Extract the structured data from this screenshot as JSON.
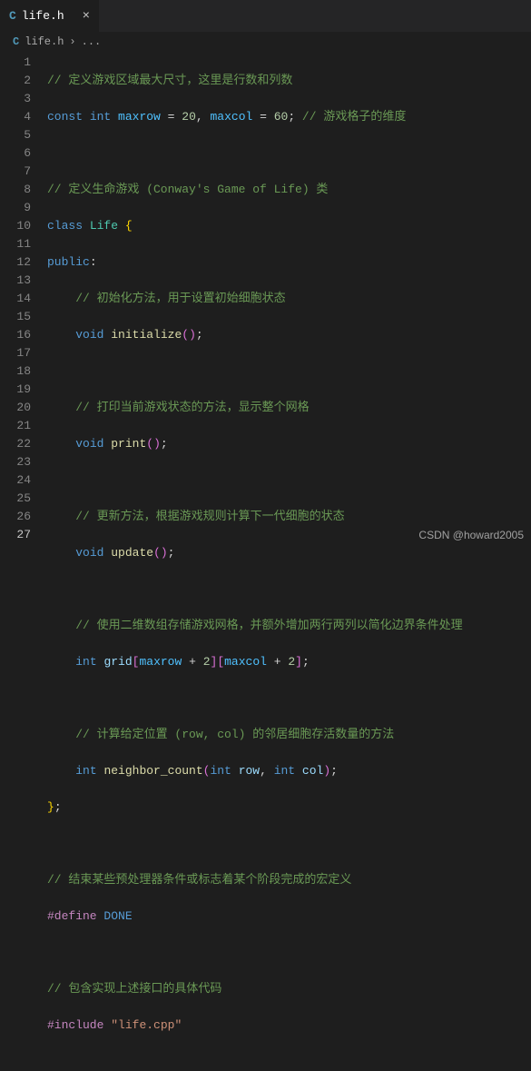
{
  "tab": {
    "icon_letter": "C",
    "label": "life.h",
    "close_glyph": "×"
  },
  "breadcrumb": {
    "icon_letter": "C",
    "file": "life.h",
    "chevron": "›",
    "trail": "..."
  },
  "watermark": "CSDN @howard2005",
  "line_count": 27,
  "active_line": 27,
  "c": {
    "l1": "// 定义游戏区域最大尺寸，这里是行数和列数",
    "l2_const": "const",
    "l2_int": "int",
    "l2_maxrow": "maxrow",
    "l2_eq1": " = ",
    "l2_20": "20",
    "l2_comma": ", ",
    "l2_maxcol": "maxcol",
    "l2_eq2": " = ",
    "l2_60": "60",
    "l2_semi": ";",
    "l2_tail": " // 游戏格子的维度",
    "l4": "// 定义生命游戏 (Conway's Game of Life) 类",
    "l5_class": "class",
    "l5_Life": "Life",
    "l5_brace": " {",
    "l6_public": "public",
    "l6_colon": ":",
    "l7": "// 初始化方法，用于设置初始细胞状态",
    "l8_void": "void",
    "l8_fn": "initialize",
    "l8_paren": "()",
    "l8_semi": ";",
    "l10": "// 打印当前游戏状态的方法，显示整个网格",
    "l11_void": "void",
    "l11_fn": "print",
    "l11_paren": "()",
    "l11_semi": ";",
    "l13": "// 更新方法，根据游戏规则计算下一代细胞的状态",
    "l14_void": "void",
    "l14_fn": "update",
    "l14_paren": "()",
    "l14_semi": ";",
    "l16": "// 使用二维数组存储游戏网格，并额外增加两行两列以简化边界条件处理",
    "l17_int": "int",
    "l17_grid": "grid",
    "l17_ob1": "[",
    "l17_maxrow": "maxrow",
    "l17_plus1": " + ",
    "l17_2a": "2",
    "l17_cb1": "]",
    "l17_ob2": "[",
    "l17_maxcol": "maxcol",
    "l17_plus2": " + ",
    "l17_2b": "2",
    "l17_cb2": "]",
    "l17_semi": ";",
    "l19": "// 计算给定位置 (row, col) 的邻居细胞存活数量的方法",
    "l20_int": "int",
    "l20_fn": "neighbor_count",
    "l20_op": "(",
    "l20_int1": "int",
    "l20_row": "row",
    "l20_comma": ", ",
    "l20_int2": "int",
    "l20_col": "col",
    "l20_cp": ")",
    "l20_semi": ";",
    "l21_close": "}",
    "l21_semi": ";",
    "l23": "// 结束某些预处理器条件或标志着某个阶段完成的宏定义",
    "l24_define": "#define",
    "l24_done": "DONE",
    "l26": "// 包含实现上述接口的具体代码",
    "l27_include": "#include",
    "l27_str": "\"life.cpp\""
  }
}
